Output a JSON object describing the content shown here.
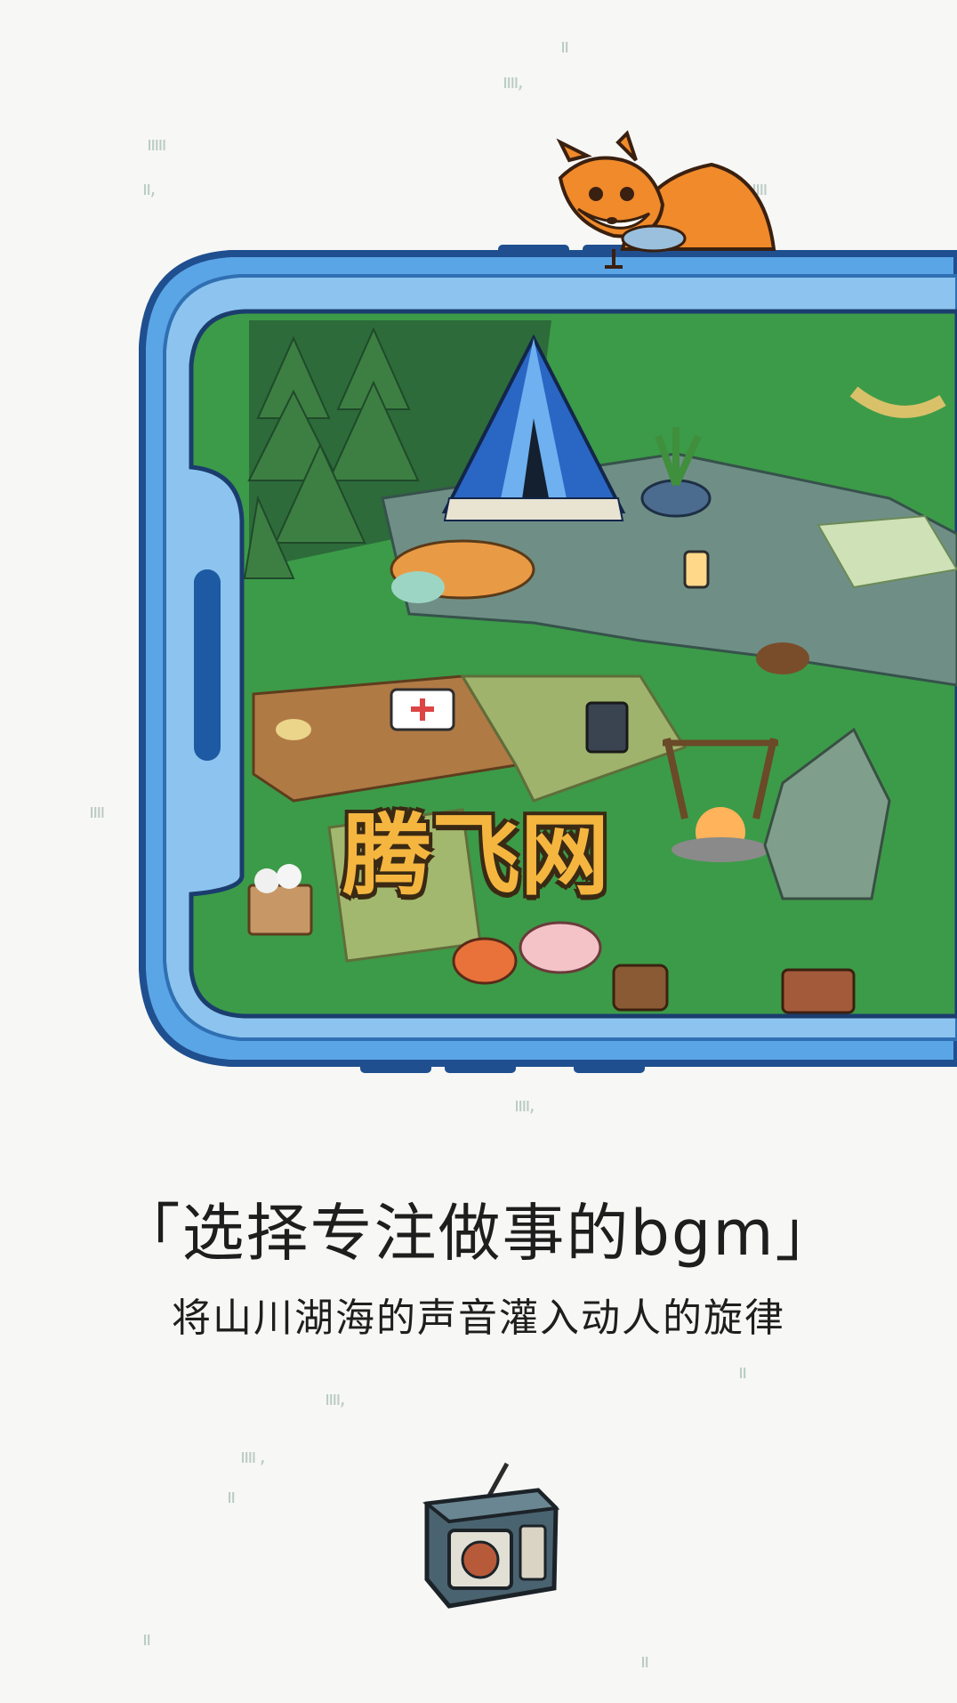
{
  "watermark": "腾飞网",
  "headline": "「选择专注做事的bgm」",
  "subline": "将山川湖海的声音灌入动人的旋律",
  "icons": {
    "mascot": "fox-icon",
    "device": "radio-icon",
    "decor": "grass-tuft-icon"
  },
  "colors": {
    "background": "#f7f7f5",
    "phone_frame": "#5aa5e6",
    "phone_frame_dark": "#1f5ea8",
    "grass_field": "#3aa04a",
    "watermark_fill": "#f5b640"
  }
}
